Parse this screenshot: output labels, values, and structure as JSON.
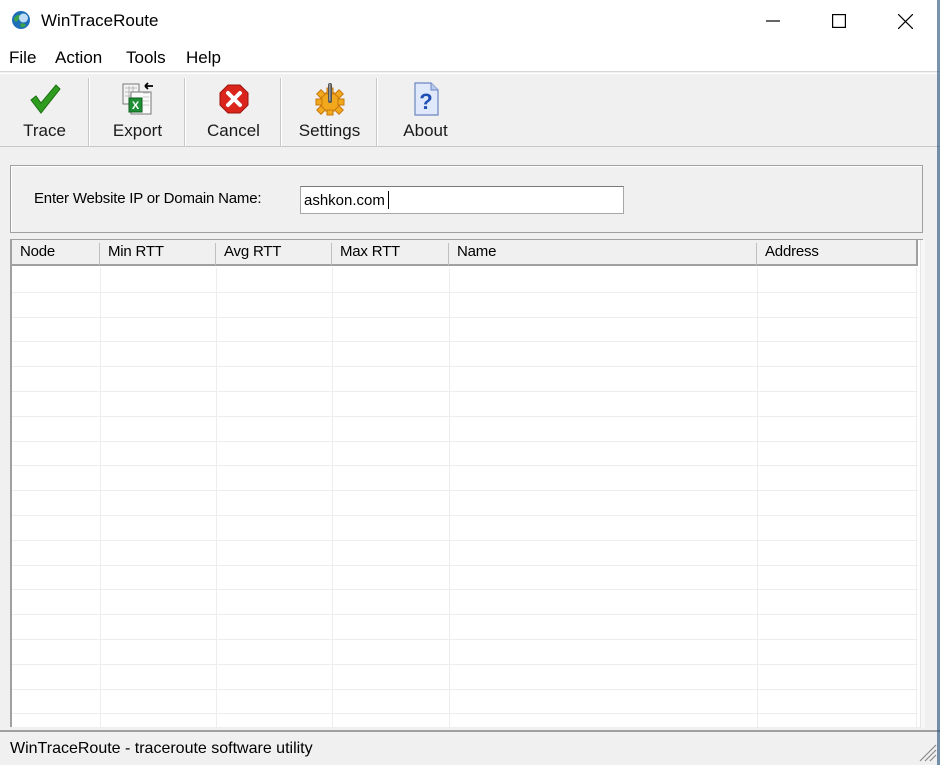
{
  "window": {
    "title": "WinTraceRoute",
    "app_icon": "globe-icon",
    "controls": {
      "minimize": "minimize-icon",
      "maximize": "maximize-icon",
      "close": "close-icon"
    }
  },
  "menu": {
    "items": [
      {
        "label": "File"
      },
      {
        "label": "Action"
      },
      {
        "label": "Tools"
      },
      {
        "label": "Help"
      }
    ]
  },
  "toolbar": {
    "buttons": [
      {
        "label": "Trace",
        "icon": "checkmark-icon"
      },
      {
        "label": "Export",
        "icon": "excel-export-icon"
      },
      {
        "label": "Cancel",
        "icon": "cancel-icon"
      },
      {
        "label": "Settings",
        "icon": "settings-gear-icon"
      },
      {
        "label": "About",
        "icon": "help-document-icon"
      }
    ]
  },
  "form": {
    "label": "Enter Website IP or Domain Name:",
    "domain_value": "ashkon.com"
  },
  "table": {
    "columns": [
      "Node",
      "Min RTT",
      "Avg RTT",
      "Max RTT",
      "Name",
      "Address"
    ],
    "rows": []
  },
  "status": {
    "text": "WinTraceRoute - traceroute software utility"
  },
  "colors": {
    "trace_green": "#2e9d1f",
    "cancel_red": "#d9251c",
    "settings_orange": "#f2a81d",
    "about_blue": "#1f4fb5"
  }
}
